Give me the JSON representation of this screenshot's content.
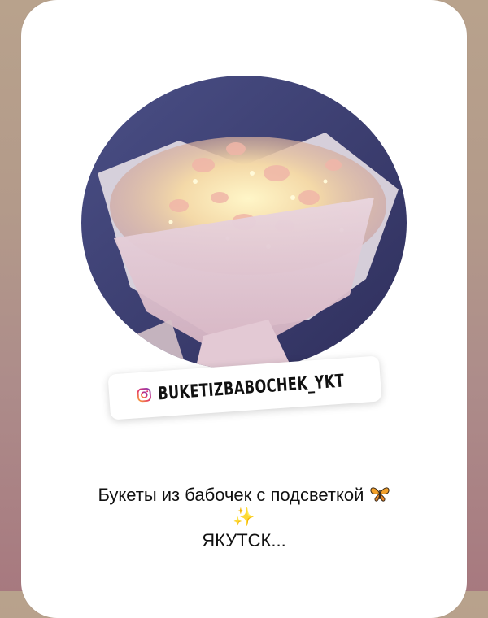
{
  "story": {
    "mention_handle": "BUKETIZBABOCHEK_YKT",
    "caption_line1": "Букеты из бабочек с подсветкой",
    "caption_line2": "✨",
    "caption_line3": "ЯКУТСК...",
    "icons": {
      "mention": "instagram-icon",
      "emoji1": "butterfly-icon",
      "emoji2": "sparkles-icon"
    },
    "colors": {
      "background_top": "#b8a28c",
      "background_bottom": "#a7797f",
      "card": "#ffffff"
    }
  }
}
